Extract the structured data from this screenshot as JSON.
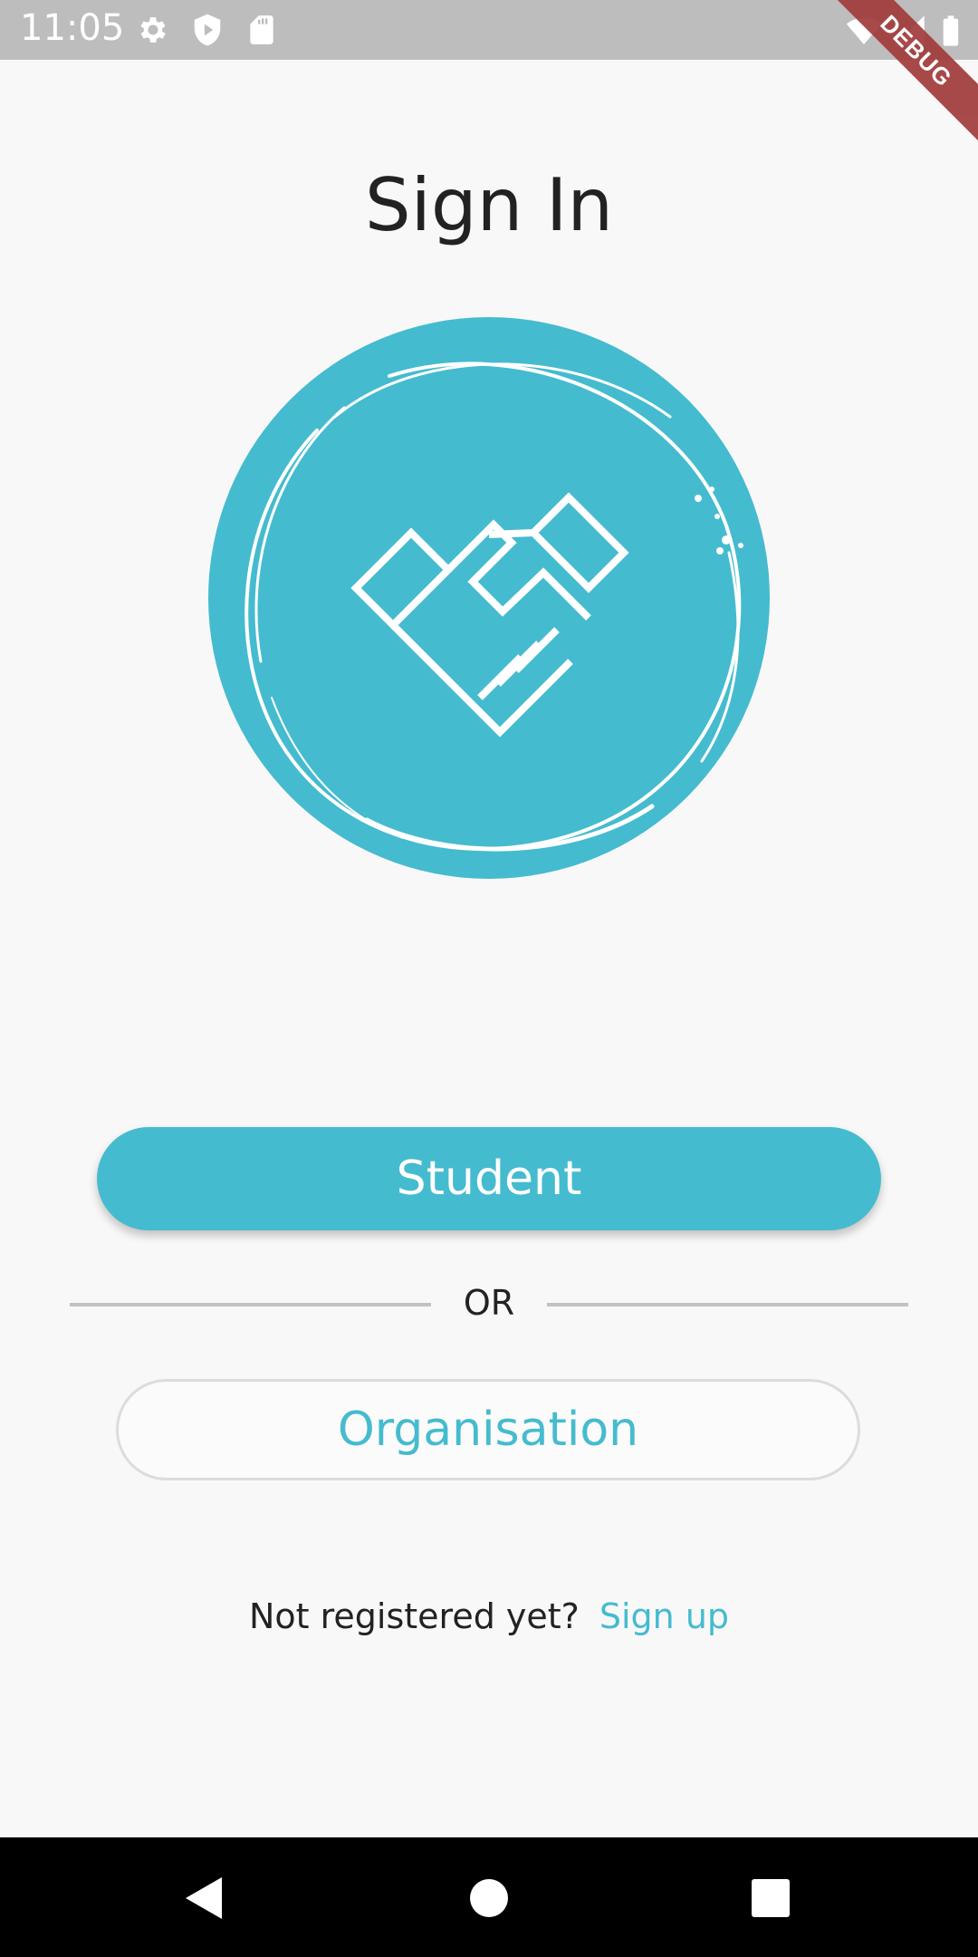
{
  "status_bar": {
    "time": "11:05",
    "icons": [
      "gear-icon",
      "shield-play-icon",
      "sd-card-icon",
      "wifi-icon",
      "signal-icon",
      "battery-icon"
    ],
    "background": "#bdbdbd"
  },
  "debug_banner": {
    "label": "DEBUG",
    "color": "#a23b3b"
  },
  "page": {
    "title": "Sign In"
  },
  "logo": {
    "icon": "handshake-icon",
    "color": "#45bbcf"
  },
  "buttons": {
    "student_label": "Student",
    "or_label": "OR",
    "organisation_label": "Organisation"
  },
  "signup": {
    "prompt": "Not registered yet?",
    "link": "Sign up"
  },
  "nav_bar": {
    "icons": [
      "back-icon",
      "home-icon",
      "recents-icon"
    ]
  },
  "colors": {
    "accent": "#45bbcf",
    "background": "#f8f8f8",
    "text": "#222222"
  }
}
